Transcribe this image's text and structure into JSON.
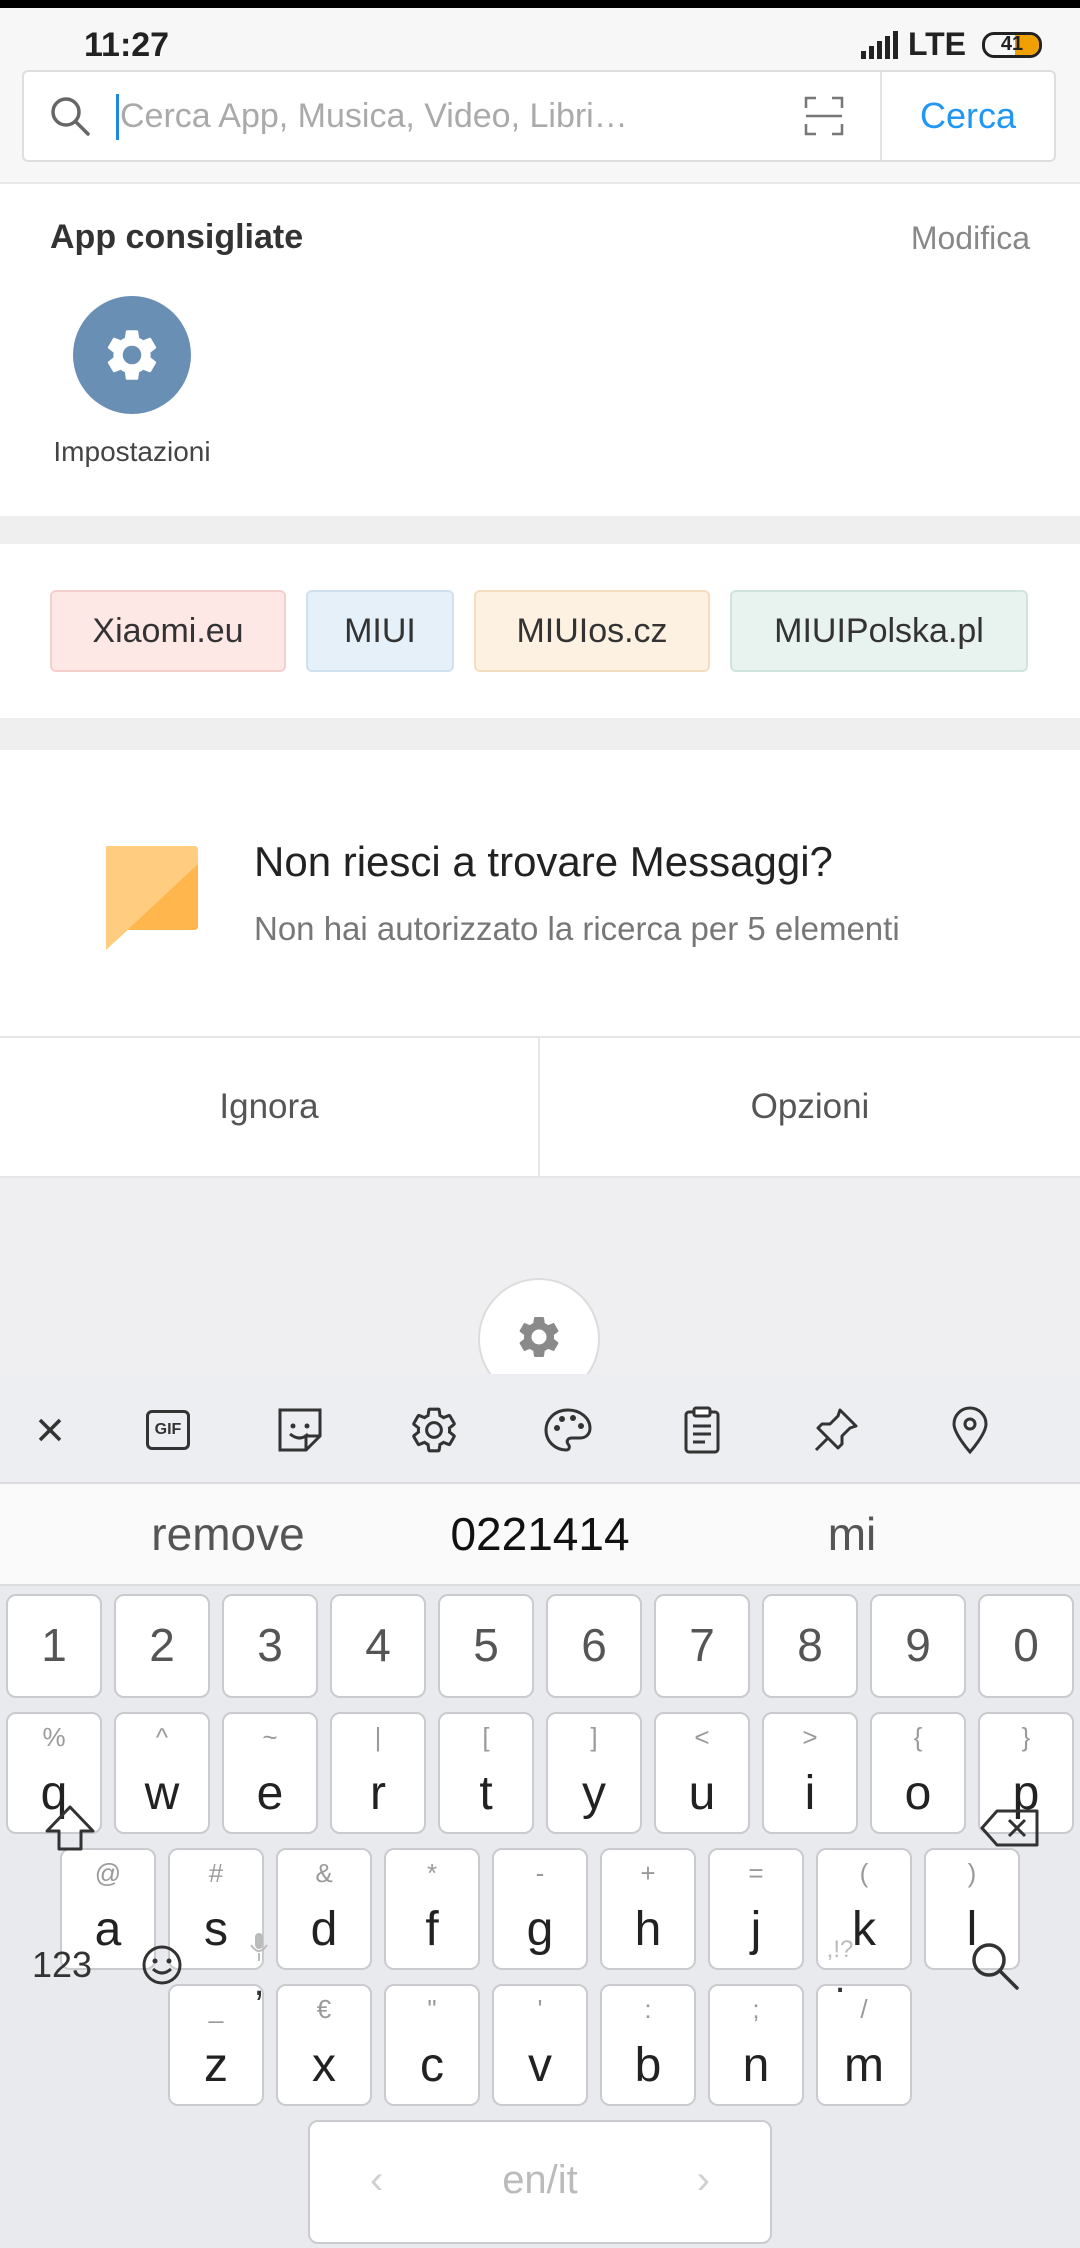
{
  "status": {
    "time": "11:27",
    "network": "LTE",
    "battery": "41"
  },
  "search": {
    "placeholder": "Cerca App, Musica, Video, Libri…",
    "button": "Cerca"
  },
  "recommended": {
    "title": "App consigliate",
    "edit": "Modifica",
    "apps": [
      {
        "label": "Impostazioni",
        "icon": "gear-icon",
        "color": "#6a8fb5"
      }
    ]
  },
  "chips": [
    {
      "label": "Xiaomi.eu",
      "bg": "#fde8e6",
      "border": "#f5cfcb"
    },
    {
      "label": "MIUI",
      "bg": "#e6f0f8",
      "border": "#cfe0ee"
    },
    {
      "label": "MIUIos.cz",
      "bg": "#fdf1e2",
      "border": "#f3dcc0"
    },
    {
      "label": "MIUIPolska.pl",
      "bg": "#e8f3ef",
      "border": "#cfe5dc"
    }
  ],
  "notice": {
    "title": "Non riesci a trovare Messaggi?",
    "subtitle": "Non hai autorizzato la ricerca per 5 elementi",
    "ignore": "Ignora",
    "options": "Opzioni",
    "icon_color": "#ffb74d"
  },
  "keyboard": {
    "toolbar": [
      "close-icon",
      "gif-icon",
      "sticker-icon",
      "settings-icon",
      "theme-palette-icon",
      "clipboard-icon",
      "pin-icon",
      "location-icon"
    ],
    "gif_label": "GIF",
    "suggestions": [
      "remove",
      "0221414",
      "mi"
    ],
    "numbers": [
      "1",
      "2",
      "3",
      "4",
      "5",
      "6",
      "7",
      "8",
      "9",
      "0"
    ],
    "row1": [
      {
        "k": "q",
        "a": "%"
      },
      {
        "k": "w",
        "a": "^"
      },
      {
        "k": "e",
        "a": "~"
      },
      {
        "k": "r",
        "a": "|"
      },
      {
        "k": "t",
        "a": "["
      },
      {
        "k": "y",
        "a": "]"
      },
      {
        "k": "u",
        "a": "<"
      },
      {
        "k": "i",
        "a": ">"
      },
      {
        "k": "o",
        "a": "{"
      },
      {
        "k": "p",
        "a": "}"
      }
    ],
    "row2": [
      {
        "k": "a",
        "a": "@"
      },
      {
        "k": "s",
        "a": "#"
      },
      {
        "k": "d",
        "a": "&"
      },
      {
        "k": "f",
        "a": "*"
      },
      {
        "k": "g",
        "a": "-"
      },
      {
        "k": "h",
        "a": "+"
      },
      {
        "k": "j",
        "a": "="
      },
      {
        "k": "k",
        "a": "("
      },
      {
        "k": "l",
        "a": ")"
      }
    ],
    "row3": [
      {
        "k": "z",
        "a": "_"
      },
      {
        "k": "x",
        "a": "€"
      },
      {
        "k": "c",
        "a": "\""
      },
      {
        "k": "v",
        "a": "'"
      },
      {
        "k": "b",
        "a": ":"
      },
      {
        "k": "n",
        "a": ";"
      },
      {
        "k": "m",
        "a": "/"
      }
    ],
    "numbers_key": "123",
    "comma": ",",
    "space_label": "en/it",
    "period": ".",
    "period_alt": ",!?"
  }
}
